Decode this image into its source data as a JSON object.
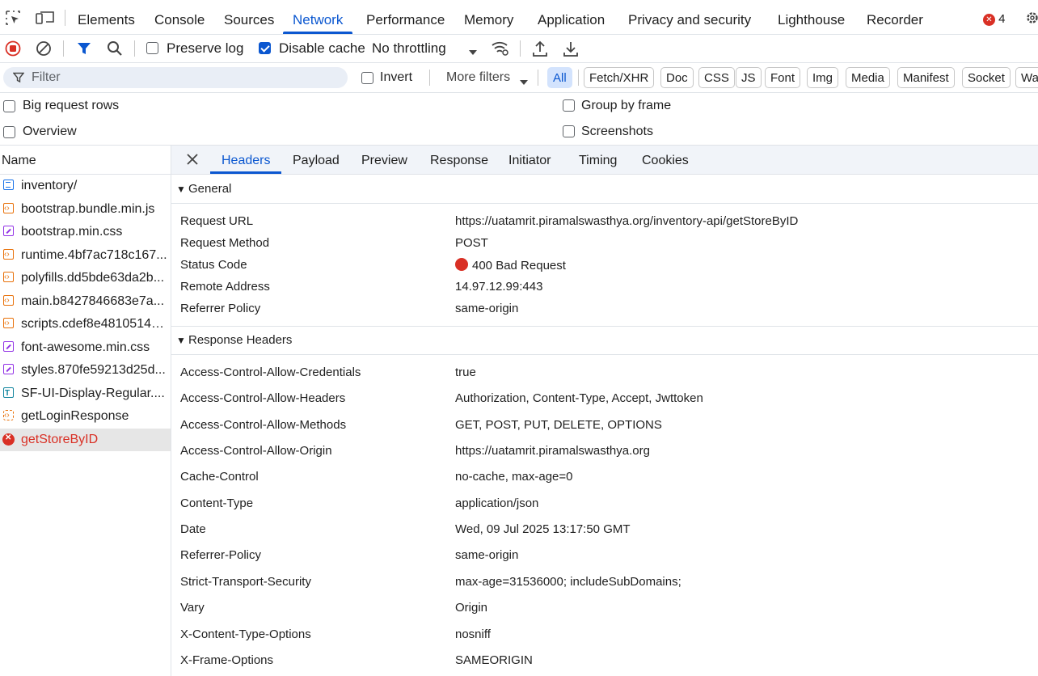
{
  "top_tabs": [
    "Elements",
    "Console",
    "Sources",
    "Network",
    "Performance",
    "Memory",
    "Application",
    "Privacy and security",
    "Lighthouse",
    "Recorder"
  ],
  "active_top_tab": "Network",
  "error_count": "4",
  "toolbar": {
    "preserve_log": "Preserve log",
    "preserve_log_checked": false,
    "disable_cache": "Disable cache",
    "disable_cache_checked": true,
    "throttling": "No throttling"
  },
  "filter": {
    "placeholder": "Filter",
    "invert": "Invert",
    "more_filters": "More filters",
    "types": [
      "All",
      "Fetch/XHR",
      "Doc",
      "CSS",
      "JS",
      "Font",
      "Img",
      "Media",
      "Manifest",
      "Socket",
      "Wa"
    ],
    "active_type": "All"
  },
  "options": {
    "big_request_rows": "Big request rows",
    "group_by_frame": "Group by frame",
    "overview": "Overview",
    "screenshots": "Screenshots"
  },
  "requests": {
    "header": "Name",
    "items": [
      {
        "name": "inventory/",
        "type": "doc"
      },
      {
        "name": "bootstrap.bundle.min.js",
        "type": "js"
      },
      {
        "name": "bootstrap.min.css",
        "type": "css"
      },
      {
        "name": "runtime.4bf7ac718c167...",
        "type": "js"
      },
      {
        "name": "polyfills.dd5bde63da2b...",
        "type": "js"
      },
      {
        "name": "main.b8427846683e7a...",
        "type": "js"
      },
      {
        "name": "scripts.cdef8e4810514e...",
        "type": "js"
      },
      {
        "name": "font-awesome.min.css",
        "type": "css"
      },
      {
        "name": "styles.870fe59213d25d...",
        "type": "css"
      },
      {
        "name": "SF-UI-Display-Regular....",
        "type": "font"
      },
      {
        "name": "getLoginResponse",
        "type": "xhr"
      },
      {
        "name": "getStoreByID",
        "type": "err"
      }
    ]
  },
  "detail_tabs": [
    "Headers",
    "Payload",
    "Preview",
    "Response",
    "Initiator",
    "Timing",
    "Cookies"
  ],
  "active_detail_tab": "Headers",
  "general": {
    "title": "General",
    "rows": [
      {
        "key": "Request URL",
        "value": "https://uatamrit.piramalswasthya.org/inventory-api/getStoreByID"
      },
      {
        "key": "Request Method",
        "value": "POST"
      },
      {
        "key": "Status Code",
        "value": "400 Bad Request"
      },
      {
        "key": "Remote Address",
        "value": "14.97.12.99:443"
      },
      {
        "key": "Referrer Policy",
        "value": "same-origin"
      }
    ]
  },
  "response_headers": {
    "title": "Response Headers",
    "rows": [
      {
        "key": "Access-Control-Allow-Credentials",
        "value": "true"
      },
      {
        "key": "Access-Control-Allow-Headers",
        "value": "Authorization, Content-Type, Accept, Jwttoken"
      },
      {
        "key": "Access-Control-Allow-Methods",
        "value": "GET, POST, PUT, DELETE, OPTIONS"
      },
      {
        "key": "Access-Control-Allow-Origin",
        "value": "https://uatamrit.piramalswasthya.org"
      },
      {
        "key": "Cache-Control",
        "value": "no-cache, max-age=0"
      },
      {
        "key": "Content-Type",
        "value": "application/json"
      },
      {
        "key": "Date",
        "value": "Wed, 09 Jul 2025 13:17:50 GMT"
      },
      {
        "key": "Referrer-Policy",
        "value": "same-origin"
      },
      {
        "key": "Strict-Transport-Security",
        "value": "max-age=31536000; includeSubDomains;"
      },
      {
        "key": "Vary",
        "value": "Origin"
      },
      {
        "key": "X-Content-Type-Options",
        "value": "nosniff"
      },
      {
        "key": "X-Frame-Options",
        "value": "SAMEORIGIN"
      }
    ]
  },
  "colors": {
    "accent": "#0b57d0",
    "error": "#d93025"
  }
}
